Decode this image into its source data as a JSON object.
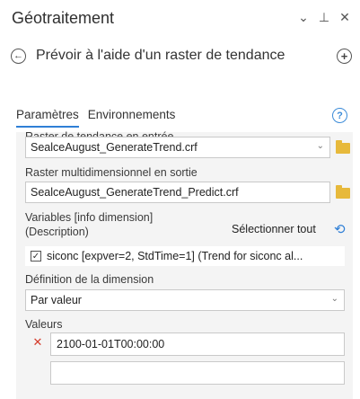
{
  "pane": {
    "title": "Géotraitement",
    "controls": {
      "menu": "⌄",
      "pin": "⊥",
      "close": "✕"
    }
  },
  "tool": {
    "back_icon": "back-arrow-icon",
    "back_glyph": "←",
    "name": "Prévoir à l'aide d'un raster de tendance",
    "add_glyph": "+"
  },
  "tabs": [
    {
      "label": "Paramètres",
      "active": true
    },
    {
      "label": "Environnements",
      "active": false
    }
  ],
  "help_glyph": "?",
  "params": {
    "in_raster_label": "Raster de tendance en entrée",
    "in_raster_value": "SealceAugust_GenerateTrend.crf",
    "out_raster_label": "Raster multidimensionnel en sortie",
    "out_raster_value": "SealceAugust_GenerateTrend_Predict.crf",
    "variables_label_line1": "Variables [info dimension]",
    "variables_label_line2": "(Description)",
    "select_all_label": "Sélectionner tout",
    "refresh_glyph": "⟲",
    "variable_item": "siconc [expver=2, StdTime=1] (Trend for siconc al...",
    "variable_checked": true,
    "check_glyph": "✓",
    "dimension_label": "Définition de la dimension",
    "dimension_value": "Par valeur",
    "values_label": "Valeurs",
    "values": [
      "2100-01-01T00:00:00",
      ""
    ],
    "remove_glyph": "✕"
  },
  "colors": {
    "accent": "#2f7fd6",
    "folder": "#e7b93b",
    "remove": "#d43b2b",
    "panel_bg": "#f4f4f4"
  }
}
